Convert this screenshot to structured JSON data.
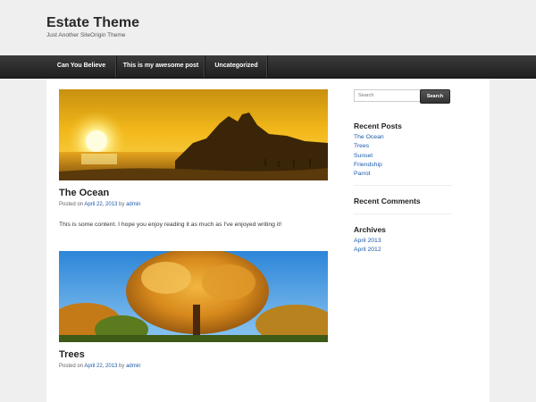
{
  "site": {
    "title": "Estate Theme",
    "tagline": "Just Another SiteOrigin Theme"
  },
  "nav": {
    "items": [
      {
        "label": "Can You Believe"
      },
      {
        "label": "This is my awesome post"
      },
      {
        "label": "Uncategorized"
      }
    ]
  },
  "posts": [
    {
      "title": "The Ocean",
      "meta_prefix": "Posted on ",
      "date": "April 22, 2013",
      "meta_by": " by ",
      "author": "admin",
      "excerpt": "This is some content. I hope you enjoy reading it as much as I've enjoyed writing it!"
    },
    {
      "title": "Trees",
      "meta_prefix": "Posted on ",
      "date": "April 22, 2013",
      "meta_by": " by ",
      "author": "admin"
    }
  ],
  "sidebar": {
    "search": {
      "placeholder": "Search",
      "button_label": "Search"
    },
    "recent_posts": {
      "title": "Recent Posts",
      "items": [
        "The Ocean",
        "Trees",
        "Sunset",
        "Friendship",
        "Parrot"
      ]
    },
    "recent_comments": {
      "title": "Recent Comments"
    },
    "archives": {
      "title": "Archives",
      "items": [
        "April 2013",
        "April 2012"
      ]
    }
  },
  "colors": {
    "link": "#1a5aa8",
    "nav_bg": "#2b2b2b",
    "page_bg": "#efefef"
  }
}
